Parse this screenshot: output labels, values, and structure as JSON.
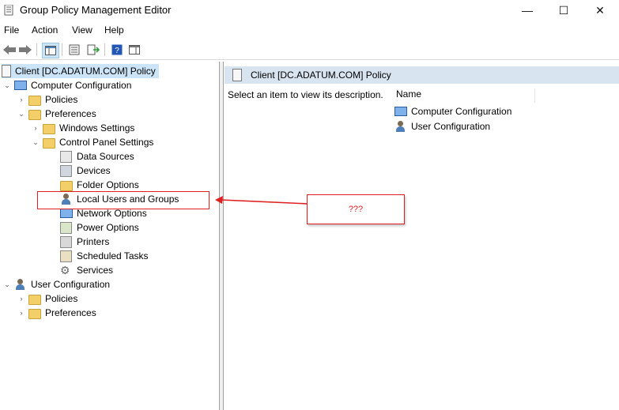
{
  "window": {
    "title": "Group Policy Management Editor",
    "minimize": "—",
    "maximize": "☐",
    "close": "✕"
  },
  "menu": [
    "File",
    "Action",
    "View",
    "Help"
  ],
  "toolbar": [
    "back-arrow",
    "forward-arrow",
    "console-tree-toggle",
    "properties",
    "export",
    "help",
    "show-hide-action"
  ],
  "tree": {
    "root": "Client [DC.ADATUM.COM] Policy",
    "computer_configuration": "Computer Configuration",
    "policies": "Policies",
    "preferences": "Preferences",
    "windows_settings": "Windows Settings",
    "control_panel_settings": "Control Panel Settings",
    "items": [
      "Data Sources",
      "Devices",
      "Folder Options",
      "Local Users and Groups",
      "Network Options",
      "Power Options",
      "Printers",
      "Scheduled Tasks",
      "Services"
    ],
    "user_configuration": "User Configuration",
    "user_policies": "Policies",
    "user_preferences": "Preferences"
  },
  "right": {
    "header": "Client [DC.ADATUM.COM] Policy",
    "description": "Select an item to view its description.",
    "column_name": "Name",
    "rows": [
      "Computer Configuration",
      "User Configuration"
    ]
  },
  "annotation": {
    "text": "???"
  },
  "colors": {
    "selection": "#cce4f7",
    "header": "#d9e4f1",
    "annotation": "#e02020"
  }
}
